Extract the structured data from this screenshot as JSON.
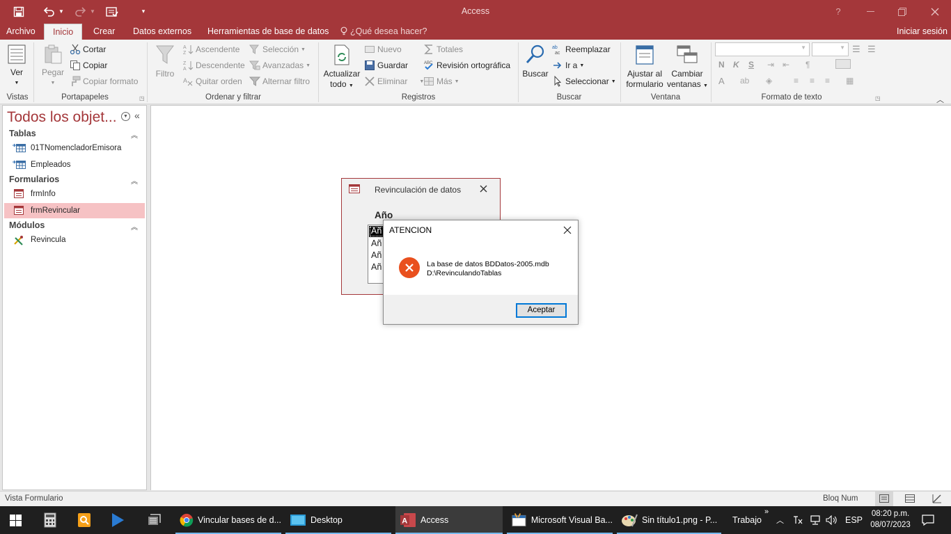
{
  "app": {
    "window_title": "Access",
    "user_action": "Iniciar sesión"
  },
  "tabs": [
    {
      "label": "Archivo"
    },
    {
      "label": "Inicio"
    },
    {
      "label": "Crear"
    },
    {
      "label": "Datos externos"
    },
    {
      "label": "Herramientas de base de datos"
    }
  ],
  "tell_me": "¿Qué desea hacer?",
  "ribbon": {
    "vistas": {
      "group": "Vistas",
      "ver": "Ver"
    },
    "portapapeles": {
      "group": "Portapapeles",
      "pegar": "Pegar",
      "cortar": "Cortar",
      "copiar": "Copiar",
      "copiar_formato": "Copiar formato"
    },
    "ordenar": {
      "group": "Ordenar y filtrar",
      "filtro": "Filtro",
      "ascendente": "Ascendente",
      "descendente": "Descendente",
      "quitar_orden": "Quitar orden",
      "seleccion": "Selección",
      "avanzadas": "Avanzadas",
      "alternar_filtro": "Alternar filtro"
    },
    "registros": {
      "group": "Registros",
      "actualizar_1": "Actualizar",
      "actualizar_2": "todo",
      "nuevo": "Nuevo",
      "guardar": "Guardar",
      "eliminar": "Eliminar",
      "totales": "Totales",
      "revision": "Revisión ortográfica",
      "mas": "Más"
    },
    "buscar": {
      "group": "Buscar",
      "buscar": "Buscar",
      "reemplazar": "Reemplazar",
      "ir_a": "Ir a",
      "seleccionar": "Seleccionar"
    },
    "ventana": {
      "group": "Ventana",
      "ajustar_1": "Ajustar al",
      "ajustar_2": "formulario",
      "cambiar_1": "Cambiar",
      "cambiar_2": "ventanas"
    },
    "formato": {
      "group": "Formato de texto",
      "bold": "N",
      "italic": "K",
      "underline": "S"
    }
  },
  "nav": {
    "header": "Todos los objet...",
    "sections": [
      {
        "label": "Tablas"
      },
      {
        "label": "Formularios"
      },
      {
        "label": "Módulos"
      }
    ],
    "tables": [
      "01TNomencladorEmisora",
      "Empleados"
    ],
    "forms": [
      "frmInfo",
      "frmRevincular"
    ],
    "modules": [
      "Revincula"
    ]
  },
  "form_window": {
    "title": "Revinculación de datos",
    "field_label": "Año",
    "list_items": [
      "Añ",
      "Añ",
      "Añ",
      "Añ"
    ]
  },
  "alert": {
    "title": "ATENCION",
    "line1": "La base de datos BDDatos-2005.mdb",
    "line2": "D:\\RevinculandoTablas",
    "ok": "Aceptar"
  },
  "status": {
    "left": "Vista Formulario",
    "right": "Bloq Num"
  },
  "taskbar": {
    "items": [
      {
        "label": "Vincular bases de d..."
      },
      {
        "label": "Desktop"
      },
      {
        "label": "Access"
      },
      {
        "label": "Microsoft Visual Ba..."
      },
      {
        "label": "Sin título1.png - P..."
      }
    ],
    "toolbar": "Trabajo",
    "lang": "ESP",
    "time": "08:20 p.m.",
    "date": "08/07/2023"
  },
  "colors": {
    "accent": "#a4373a",
    "selection": "#f6c2c4",
    "error": "#e9501e",
    "taskbar": "#1f1f1f"
  }
}
